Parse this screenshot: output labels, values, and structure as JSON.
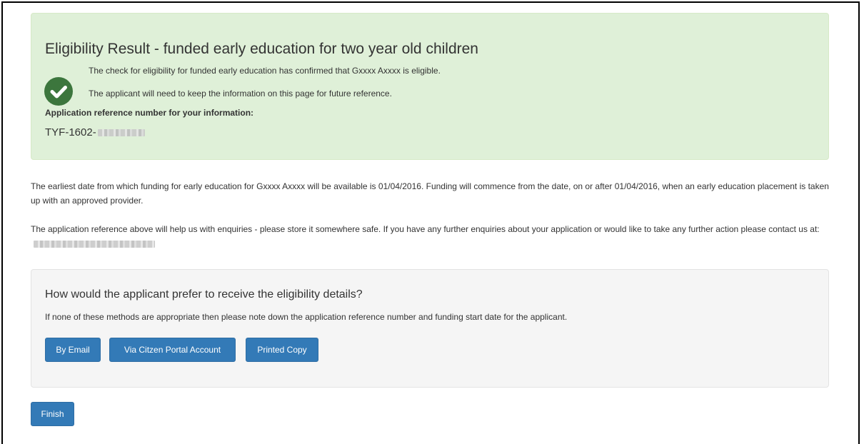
{
  "result": {
    "title": "Eligibility Result - funded early education for two year old children",
    "confirmation": "The check for eligibility for funded early education has confirmed that Gxxxx Axxxx is eligible.",
    "keep_info": "The applicant will need to keep the information on this page for future reference.",
    "reference_label": "Application reference number for your information:",
    "reference_prefix": "TYF-1602-"
  },
  "info": {
    "funding_paragraph": "The earliest date from which funding for early education for Gxxxx Axxxx will be available is 01/04/2016. Funding will commence from the date, on or after 01/04/2016, when an early education placement is taken up with an approved provider.",
    "enquiries_paragraph": "The application reference above will help us with enquiries - please store it somewhere safe. If you have any further enquiries about your application or would like to take any further action please contact us at:"
  },
  "options": {
    "question": "How would the applicant prefer to receive the eligibility details?",
    "note": "If none of these methods are appropriate then please note down the application reference number and funding start date for the applicant.",
    "buttons": {
      "email": "By Email",
      "portal": "Via Citzen Portal Account",
      "printed": "Printed Copy"
    }
  },
  "finish_label": "Finish",
  "colors": {
    "success_bg": "#dff0d8",
    "success_icon": "#3c763d",
    "primary_button": "#337ab7",
    "well_bg": "#f5f5f5"
  },
  "icons": {
    "check": "check-circle-icon"
  }
}
